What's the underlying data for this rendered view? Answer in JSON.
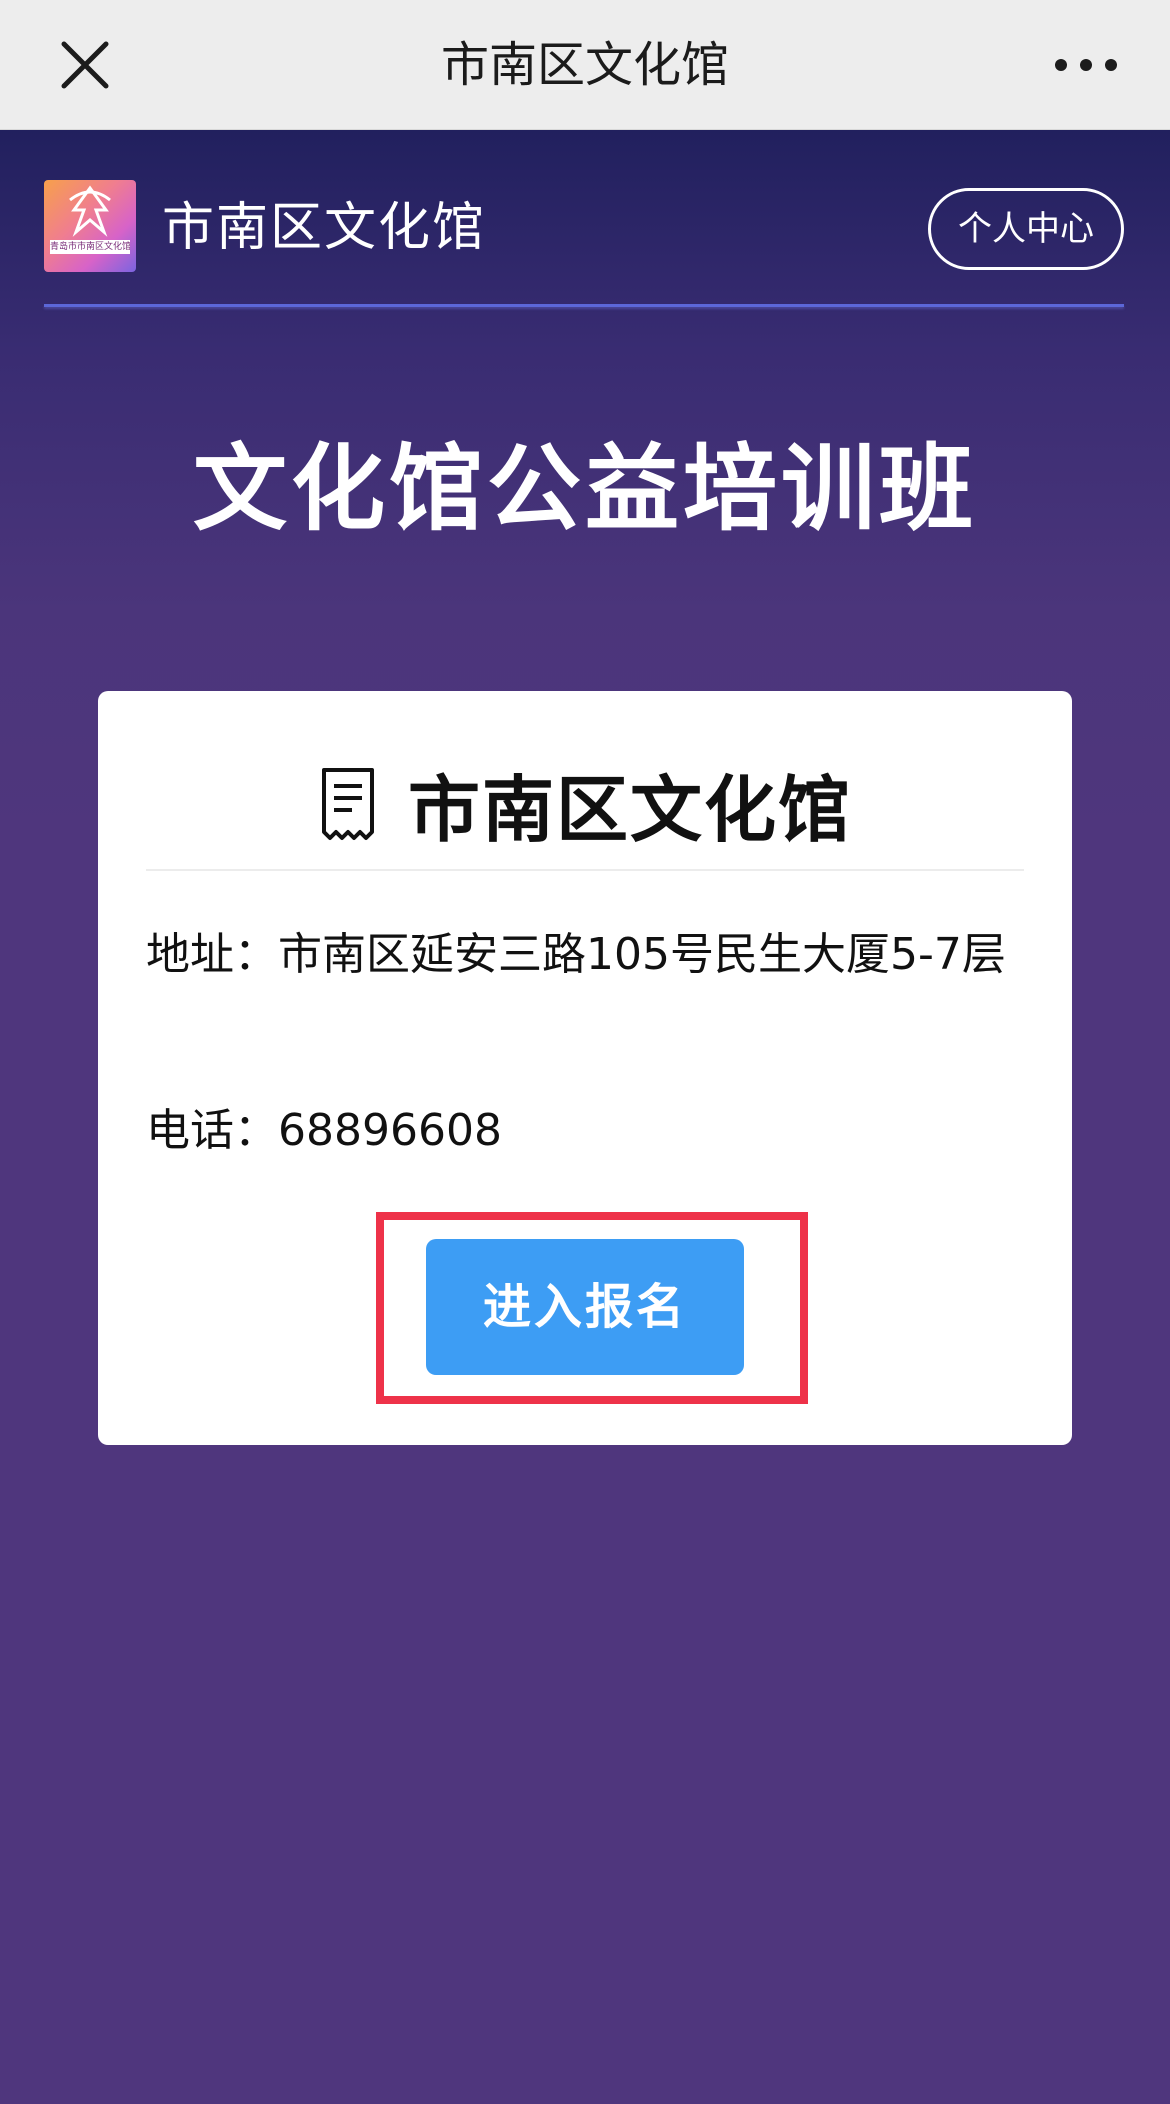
{
  "topbar": {
    "title": "市南区文化馆",
    "close_icon": "close-icon",
    "more_icon": "more-dots-icon"
  },
  "header": {
    "logo_text": "青岛市市南区文化馆",
    "site_name": "市南区文化馆",
    "user_center_label": "个人中心"
  },
  "hero": {
    "title": "文化馆公益培训班"
  },
  "card": {
    "icon": "receipt-icon",
    "title": "市南区文化馆",
    "address": "地址：市南区延安三路105号民生大厦5-7层",
    "phone": "电话：68896608",
    "enter_label": "进入报名"
  },
  "colors": {
    "page_bg": "#4f367d",
    "header_bg": "#21205e",
    "button_blue": "#3d9df4",
    "highlight_red": "#ee3249",
    "divider_blue": "#5c67d8"
  }
}
